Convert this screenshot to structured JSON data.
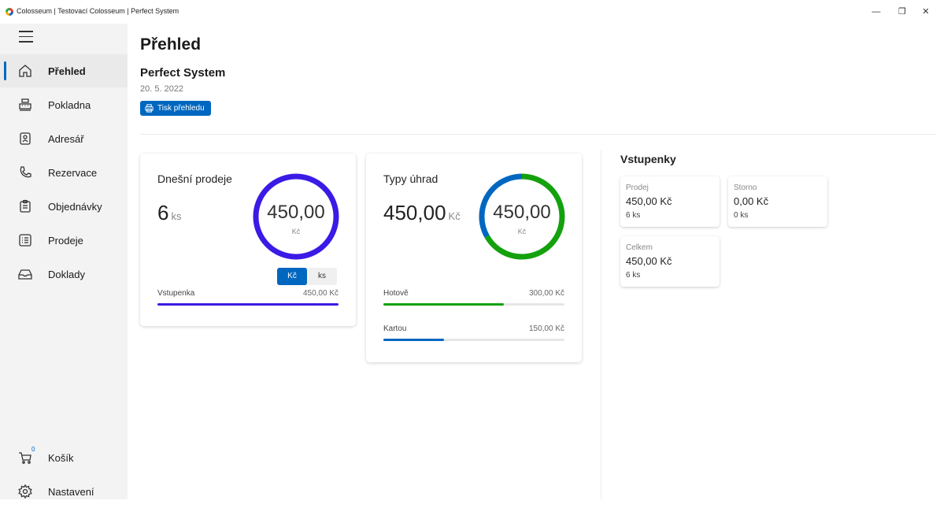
{
  "window": {
    "title": "Colosseum | Testovací Colosseum | Perfect System",
    "minimize": "—",
    "restore": "❐",
    "close": "✕"
  },
  "sidebar": {
    "items": [
      {
        "label": "Přehled",
        "icon": "home-icon",
        "active": true
      },
      {
        "label": "Pokladna",
        "icon": "cash-register-icon"
      },
      {
        "label": "Adresář",
        "icon": "contact-book-icon"
      },
      {
        "label": "Rezervace",
        "icon": "phone-icon"
      },
      {
        "label": "Objednávky",
        "icon": "clipboard-icon"
      },
      {
        "label": "Prodeje",
        "icon": "list-icon"
      },
      {
        "label": "Doklady",
        "icon": "inbox-icon"
      }
    ],
    "cart": {
      "label": "Košík",
      "badge": "0",
      "icon": "cart-icon"
    },
    "settings": {
      "label": "Nastavení",
      "icon": "gear-icon"
    }
  },
  "main": {
    "title": "Přehled",
    "company": "Perfect System",
    "date": "20. 5. 2022",
    "print_label": "Tisk přehledu"
  },
  "sales_card": {
    "title": "Dnešní prodeje",
    "count": "6",
    "count_unit": "ks",
    "donut_value": "450,00",
    "donut_unit": "Kč",
    "donut_color": "#3a1be6",
    "toggle": [
      "Kč",
      "ks"
    ],
    "rows": [
      {
        "label": "Vstupenka",
        "value": "450,00 Kč",
        "fraction": 1.0,
        "color": "#3a1be6"
      }
    ]
  },
  "payment_card": {
    "title": "Typy úhrad",
    "amount": "450,00",
    "amount_unit": "Kč",
    "donut_value": "450,00",
    "donut_unit": "Kč",
    "rows": [
      {
        "label": "Hotově",
        "value": "300,00 Kč",
        "fraction": 0.667,
        "color": "#13a10e"
      },
      {
        "label": "Kartou",
        "value": "150,00 Kč",
        "fraction": 0.333,
        "color": "#0067c0"
      }
    ]
  },
  "tickets": {
    "title": "Vstupenky",
    "items": [
      {
        "label": "Prodej",
        "amount": "450,00 Kč",
        "count": "6 ks"
      },
      {
        "label": "Storno",
        "amount": "0,00 Kč",
        "count": "0 ks"
      },
      {
        "label": "Celkem",
        "amount": "450,00 Kč",
        "count": "6 ks"
      }
    ]
  }
}
